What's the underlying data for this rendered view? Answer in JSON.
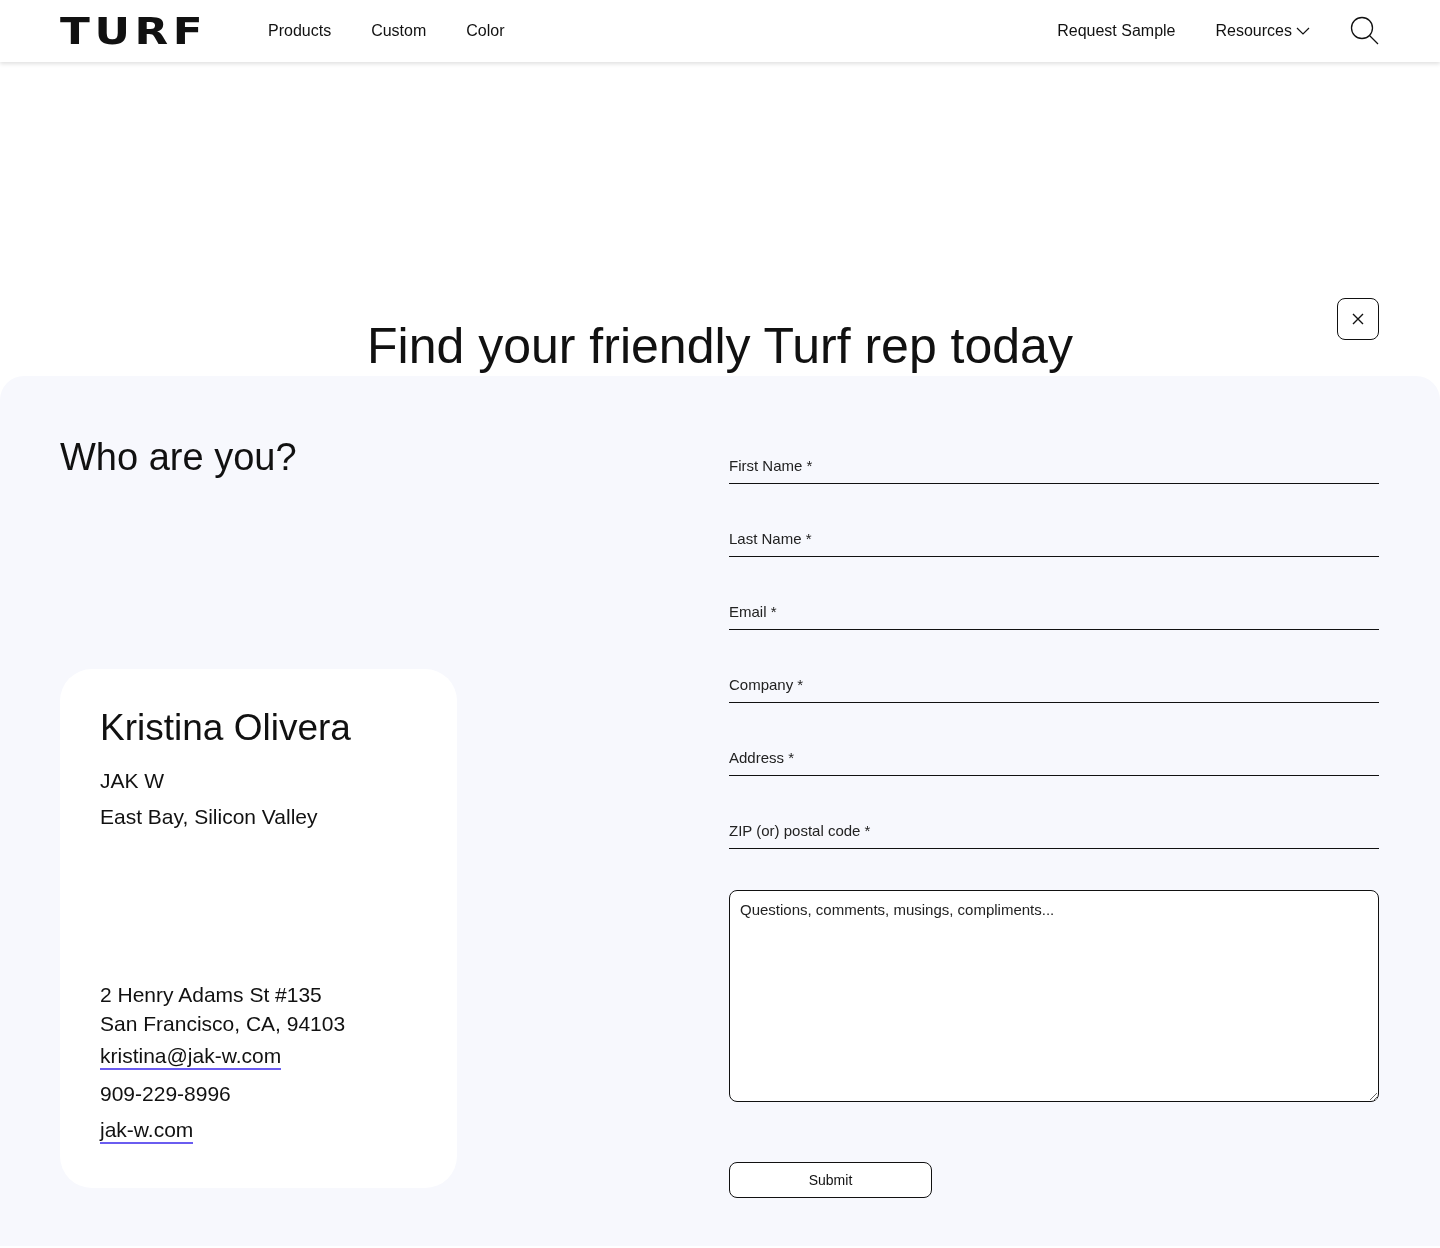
{
  "header": {
    "logo": "TURF",
    "nav": [
      "Products",
      "Custom",
      "Color"
    ],
    "right_nav": [
      {
        "label": "Request Sample",
        "kind": "link"
      },
      {
        "label": "Resources",
        "kind": "dropdown"
      }
    ]
  },
  "heading": "Find your friendly Turf rep today",
  "form_title": "Who are you?",
  "rep": {
    "name": "Kristina Olivera",
    "company": "JAK W",
    "region": "East Bay, Silicon Valley",
    "address": [
      "2 Henry Adams St #135",
      "San Francisco, CA, 94103"
    ],
    "email": "kristina@jak-w.com",
    "phone": "909-229-8996",
    "website": "jak-w.com"
  },
  "fields": [
    {
      "placeholder": "First Name *"
    },
    {
      "placeholder": "Last Name *"
    },
    {
      "placeholder": "Email *"
    },
    {
      "placeholder": "Company *"
    },
    {
      "placeholder": "Address *"
    },
    {
      "placeholder": "ZIP (or) postal code *"
    }
  ],
  "message": {
    "placeholder": "Questions, comments, musings, compliments..."
  },
  "submit": "Submit"
}
